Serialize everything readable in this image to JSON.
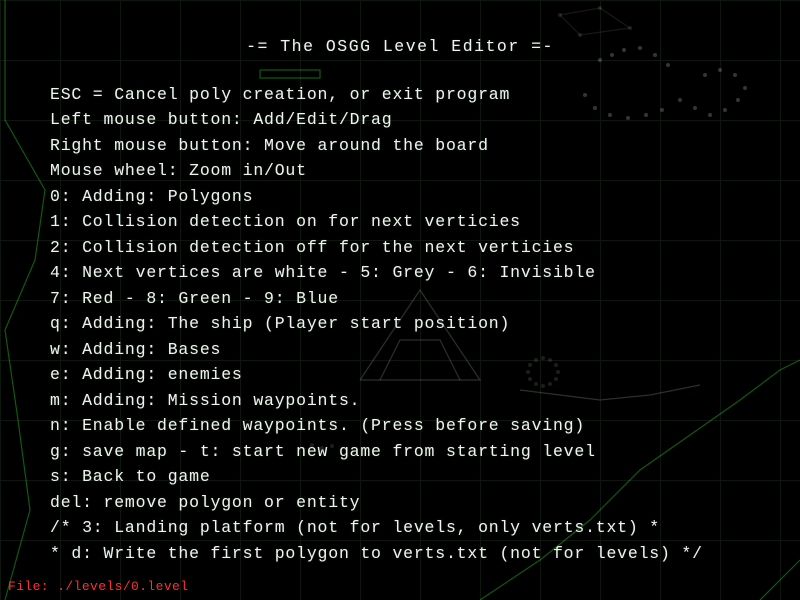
{
  "title": "-= The OSGG Level Editor =-",
  "help_lines": [
    "ESC = Cancel poly creation, or exit program",
    "Left mouse button: Add/Edit/Drag",
    "Right mouse button: Move around the board",
    "Mouse wheel: Zoom in/Out",
    "0: Adding: Polygons",
    "1: Collision detection on for next verticies",
    "2: Collision detection off for the next verticies",
    "4: Next vertices are white - 5: Grey - 6: Invisible",
    "7: Red - 8: Green - 9: Blue",
    "q: Adding: The ship (Player start position)",
    "w: Adding: Bases",
    "e: Adding: enemies",
    "m: Adding: Mission waypoints.",
    "n: Enable defined waypoints. (Press before saving)",
    "g: save map - t: start new game from starting level",
    "s: Back to game",
    "del: remove polygon or entity",
    "/* 3: Landing platform (not for levels, only verts.txt)     *",
    "  * d: Write the first polygon to verts.txt (not for levels) */"
  ],
  "status_prefix": "File: ",
  "status_path": "./levels/0.level",
  "colors": {
    "text": "#f0f4f0",
    "status": "#ff3030",
    "grid": "#1a2a1a",
    "accent_green": "#2dff2d"
  }
}
